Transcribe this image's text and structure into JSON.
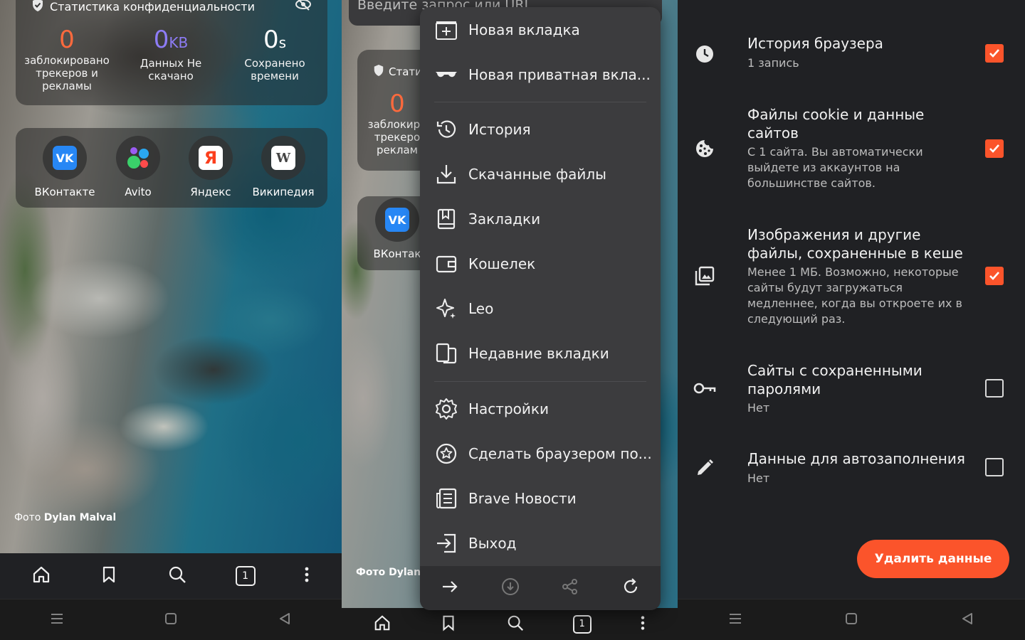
{
  "panel1": {
    "privacy_stats_title": "Статистика конфиденциальности",
    "stats": [
      {
        "value": "0",
        "unit": "",
        "label": "заблокировано трекеров и рекламы"
      },
      {
        "value": "0",
        "unit": "KB",
        "label": "Данных Не скачано"
      },
      {
        "value": "0",
        "unit": "s",
        "label": "Сохранено времени"
      }
    ],
    "top_sites": [
      {
        "label": "ВКонтакте",
        "icon": "vk-logo"
      },
      {
        "label": "Avito",
        "icon": "avito-logo"
      },
      {
        "label": "Яндекс",
        "icon": "yandex-logo",
        "glyph": "Я"
      },
      {
        "label": "Википедия",
        "icon": "wikipedia-logo",
        "glyph": "W"
      }
    ],
    "photo_credit_prefix": "Фото",
    "photo_credit_author": "Dylan Malval",
    "tab_count": "1"
  },
  "panel2": {
    "url_placeholder": "Введите запрос или URL",
    "stats_title_partial": "Стати",
    "stat_value": "0",
    "stat_label_partial": "заблокиро трекеро реклам",
    "site_label_partial": "ВКонтак",
    "photo_credit_partial": "Фото Dylan M",
    "tab_count": "1",
    "menu_items": [
      {
        "label": "Новая вкладка",
        "icon": "new-tab-icon"
      },
      {
        "label": "Новая приватная вкла...",
        "icon": "private-glasses-icon"
      },
      {
        "label": "История",
        "icon": "history-icon"
      },
      {
        "label": "Скачанные файлы",
        "icon": "download-icon"
      },
      {
        "label": "Закладки",
        "icon": "bookmarks-icon"
      },
      {
        "label": "Кошелек",
        "icon": "wallet-icon"
      },
      {
        "label": "Leo",
        "icon": "leo-sparkle-icon"
      },
      {
        "label": "Недавние вкладки",
        "icon": "recent-tabs-icon"
      },
      {
        "label": "Настройки",
        "icon": "settings-gear-icon"
      },
      {
        "label": "Сделать браузером по...",
        "icon": "default-browser-star-icon"
      },
      {
        "label": "Brave Новости",
        "icon": "news-icon"
      },
      {
        "label": "Выход",
        "icon": "exit-icon"
      }
    ]
  },
  "panel3": {
    "rows": [
      {
        "title": "История браузера",
        "subtitle": "1 запись",
        "checked": true,
        "icon": "clock-icon"
      },
      {
        "title": "Файлы cookie и данные сайтов",
        "subtitle": "С 1 сайта. Вы автоматически выйдете из аккаунтов на большинстве сайтов.",
        "checked": true,
        "icon": "cookie-icon"
      },
      {
        "title": "Изображения и другие файлы, сохраненные в кеше",
        "subtitle": "Менее 1 МБ. Возможно, некоторые сайты будут загружаться медленнее, когда вы откроете их в следующий раз.",
        "checked": true,
        "icon": "image-cache-icon"
      },
      {
        "title": "Сайты с сохраненными паролями",
        "subtitle": "Нет",
        "checked": false,
        "icon": "key-icon"
      },
      {
        "title": "Данные для автозаполнения",
        "subtitle": "Нет",
        "checked": false,
        "icon": "pencil-icon"
      }
    ],
    "delete_button": "Удалить данные"
  },
  "colors": {
    "accent": "#fb542b",
    "menu_bg": "#3c3c3e",
    "panel_bg": "#202124"
  }
}
